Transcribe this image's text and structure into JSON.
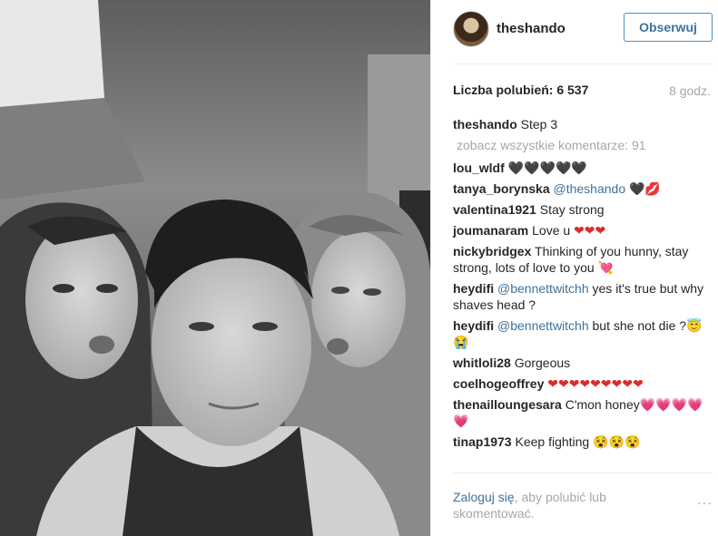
{
  "post": {
    "username": "theshando",
    "follow_label": "Obserwuj",
    "likes_text": "Liczba polubień: 6 537",
    "time_ago": "8 godz.",
    "caption_user": "theshando",
    "caption_text": "Step 3",
    "view_all_comments": "zobacz wszystkie komentarze: 91"
  },
  "comments": [
    {
      "user": "lou_wldf",
      "text": "",
      "emoji": "🖤🖤🖤🖤🖤"
    },
    {
      "user": "tanya_borynska",
      "mention": "@theshando",
      "text": "",
      "emoji": "🖤💋"
    },
    {
      "user": "valentina1921",
      "text": "Stay strong",
      "emoji": ""
    },
    {
      "user": "joumanaram",
      "text": "Love u",
      "emoji": "❤❤❤"
    },
    {
      "user": "nickybridgex",
      "text": "Thinking of you hunny, stay strong, lots of love to you",
      "emoji": "💘"
    },
    {
      "user": "heydifi",
      "mention": "@bennettwitchh",
      "text": "yes it's true but why shaves head ?",
      "emoji": ""
    },
    {
      "user": "heydifi",
      "mention": "@bennettwitchh",
      "text": "but she not die ?",
      "emoji": "😇😭"
    },
    {
      "user": "whitloli28",
      "text": "Gorgeous",
      "emoji": ""
    },
    {
      "user": "coelhogeoffrey",
      "text": "",
      "emoji": "❤❤❤❤❤❤❤❤❤"
    },
    {
      "user": "thenailloungesara",
      "text": "C'mon honey",
      "emoji": "💗💗💗💗💗"
    },
    {
      "user": "tinap1973",
      "text": "Keep fighting",
      "emoji": "😵😵😵"
    }
  ],
  "footer": {
    "login_link": "Zaloguj się",
    "login_rest": ", aby polubić lub skomentować.",
    "more_icon": "···"
  },
  "colors": {
    "link": "#3f729b",
    "muted": "#a5a7aa",
    "follow_border": "#4a90c2"
  }
}
